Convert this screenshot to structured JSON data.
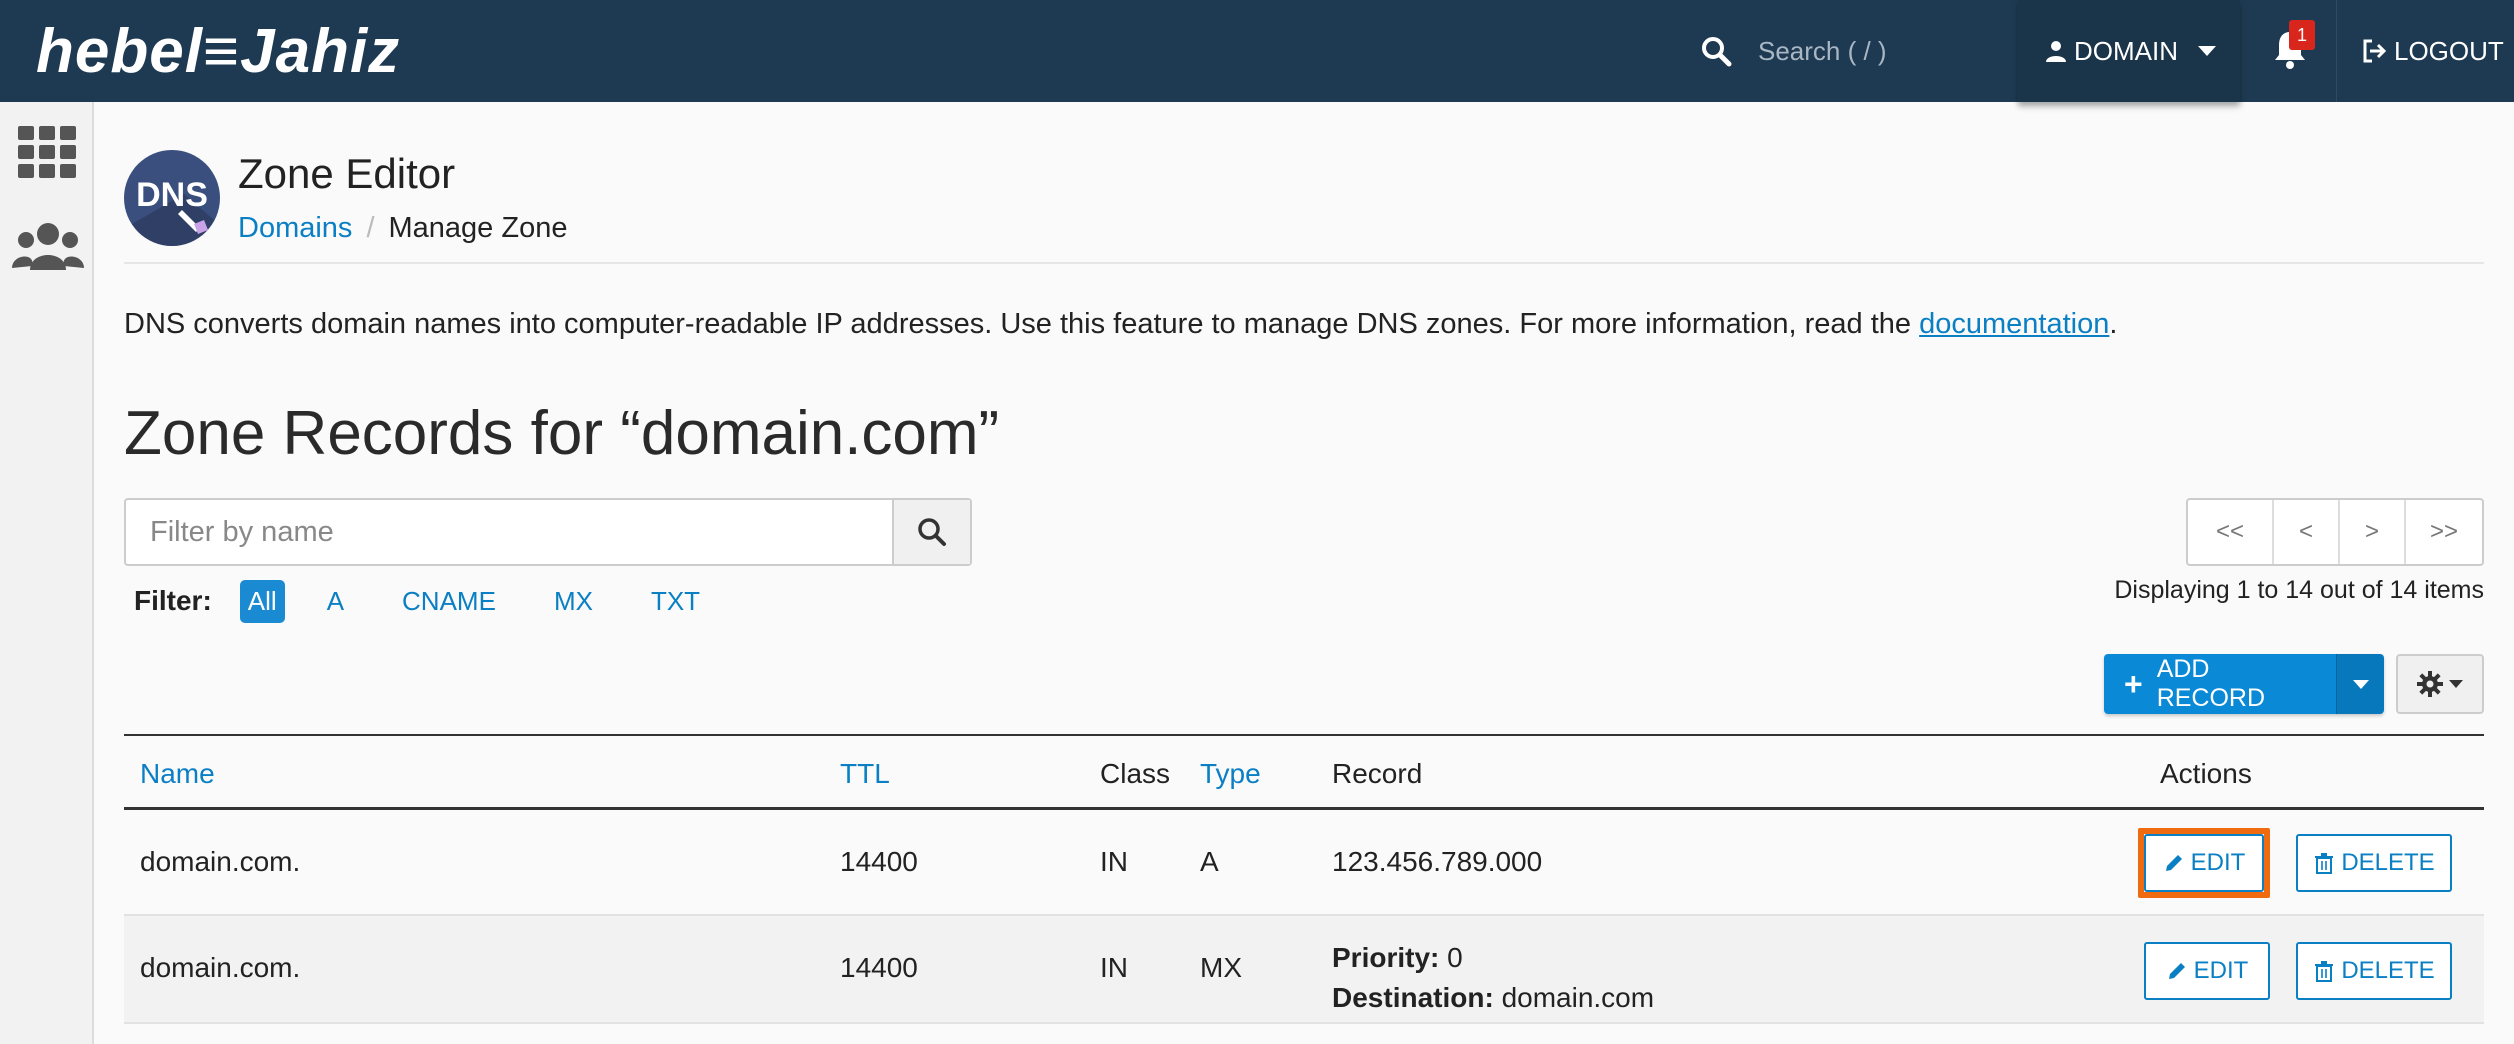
{
  "header": {
    "logo_text": "hebel≡Jahiz",
    "search_placeholder": "Search ( / )",
    "user_label": "DOMAIN",
    "notification_count": "1",
    "logout_label": "LOGOUT"
  },
  "page": {
    "title": "Zone Editor",
    "avatar_text": "DNS",
    "breadcrumb": [
      {
        "label": "Domains"
      },
      {
        "label": "Manage Zone"
      }
    ],
    "breadcrumb_sep": "/",
    "description_before": "DNS converts domain names into computer-readable IP addresses. Use this feature to manage DNS zones. For more information, read the ",
    "description_link": "documentation",
    "description_after": ".",
    "zone_title": "Zone Records for “domain.com”"
  },
  "filter": {
    "placeholder": "Filter by name",
    "label": "Filter:",
    "chips": [
      "All",
      "A",
      "CNAME",
      "MX",
      "TXT"
    ],
    "active_chip": "All"
  },
  "pagination": {
    "first": "<<",
    "prev": "<",
    "next": ">",
    "last": ">>",
    "summary": "Displaying 1 to 14 out of 14 items"
  },
  "toolbar": {
    "add_record_label": "ADD RECORD"
  },
  "table": {
    "columns": {
      "name": "Name",
      "ttl": "TTL",
      "class": "Class",
      "type": "Type",
      "record": "Record",
      "actions": "Actions"
    },
    "rows": [
      {
        "name": "domain.com.",
        "ttl": "14400",
        "class": "IN",
        "type": "A",
        "record": "123.456.789.000"
      },
      {
        "name": "domain.com.",
        "ttl": "14400",
        "class": "IN",
        "type": "MX",
        "priority_label": "Priority:",
        "priority_value": "0",
        "destination_label": "Destination:",
        "destination_value": "domain.com"
      }
    ],
    "edit_label": "EDIT",
    "delete_label": "DELETE"
  },
  "colors": {
    "topbar": "#1e3a52",
    "accent": "#0a7fc4",
    "primary_button": "#0a8ad6",
    "highlight": "#f06a10"
  }
}
